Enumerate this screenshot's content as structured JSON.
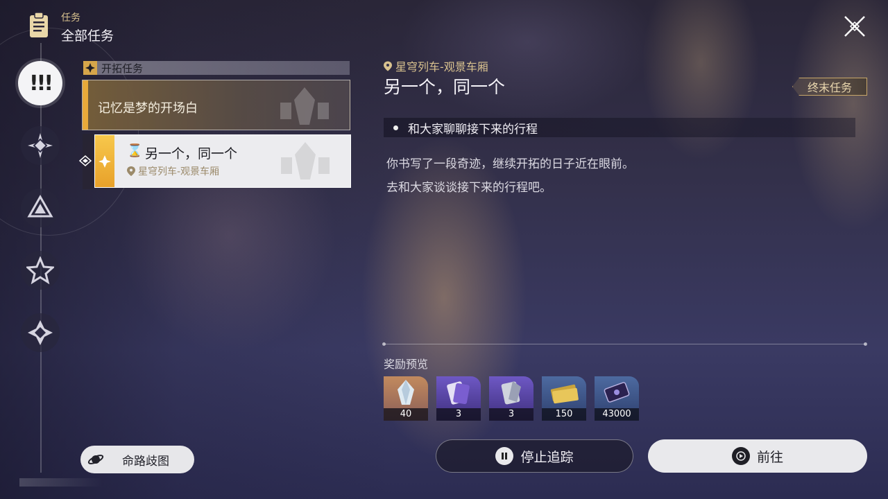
{
  "header": {
    "small_label": "任务",
    "title": "全部任务"
  },
  "quest_list": {
    "group_label": "开拓任务",
    "quests": [
      {
        "title": "记忆是梦的开场白"
      },
      {
        "title": "另一个，同一个",
        "location": "星穹列车-观景车厢",
        "hourglass": "⌛"
      }
    ]
  },
  "map_button": {
    "label": "命路歧图"
  },
  "detail": {
    "location": "星穹列车-观景车厢",
    "title": "另一个，同一个",
    "badge": "终末任务",
    "objective": "和大家聊聊接下来的行程",
    "description_lines": [
      "你书写了一段奇迹，继续开拓的日子近在眼前。",
      "去和大家谈谈接下来的行程吧。"
    ]
  },
  "rewards": {
    "label": "奖励预览",
    "items": [
      {
        "icon": "crystal-icon",
        "count": "40",
        "bg": "#b07a55"
      },
      {
        "icon": "ticket-purple-icon",
        "count": "3",
        "bg": "#5c47a6"
      },
      {
        "icon": "ticket-silver-icon",
        "count": "3",
        "bg": "#5c47a6"
      },
      {
        "icon": "credit-icon",
        "count": "150",
        "bg": "#3c5a86"
      },
      {
        "icon": "card-icon",
        "count": "43000",
        "bg": "#3c5a86"
      }
    ]
  },
  "actions": {
    "stop_label": "停止追踪",
    "go_label": "前往"
  },
  "colors": {
    "accent_gold": "#e8a93a",
    "location_gold": "#d9c28f"
  }
}
